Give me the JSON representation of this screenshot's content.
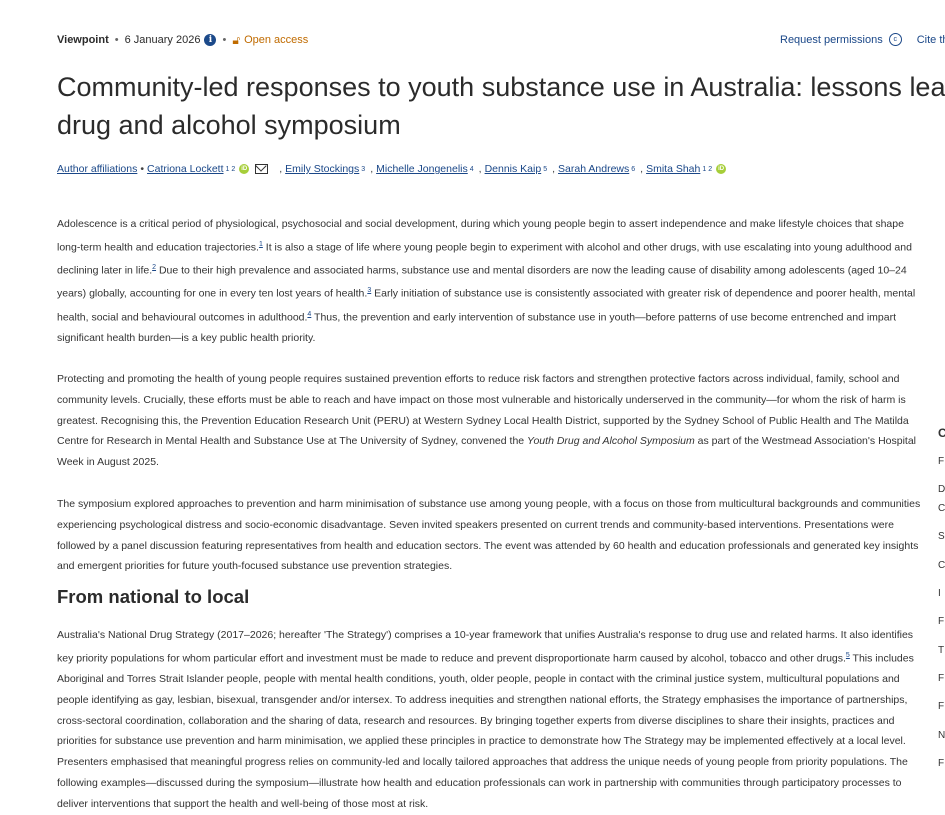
{
  "meta": {
    "article_type": "Viewpoint",
    "date": "6 January 2026",
    "access": "Open access",
    "request_permissions": "Request permissions",
    "cite": "Cite this"
  },
  "title": {
    "line1": "Community-led responses to youth substance use in Australia: lessons learnt",
    "line2": "drug and alcohol symposium"
  },
  "authors": {
    "affiliations": "Author affiliations",
    "list": [
      {
        "name": "Catriona Lockett",
        "sup": "1 2"
      },
      {
        "name": "Emily Stockings",
        "sup": "3"
      },
      {
        "name": "Michelle Jongenelis",
        "sup": "4"
      },
      {
        "name": "Dennis Kaip",
        "sup": "5"
      },
      {
        "name": "Sarah Andrews",
        "sup": "6"
      },
      {
        "name": "Smita Shah",
        "sup": "1 2"
      }
    ]
  },
  "body": {
    "p1": [
      "Adolescence is a critical period of physiological, psychosocial and social development, during which young people begin to assert independence and make lifestyle choices that shape long-term health and education trajectories.",
      "1",
      " It is also a stage of life where young people begin to experiment with alcohol and other drugs, with use escalating into young adulthood and declining later in life.",
      "2",
      " Due to their high prevalence and associated harms, substance use and mental disorders are now the leading cause of disability among adolescents (aged 10–24 years) globally, accounting for one in every ten lost years of health.",
      "3",
      " Early initiation of substance use is consistently associated with greater risk of dependence and poorer health, mental health, social and behavioural outcomes in adulthood.",
      "4",
      " Thus, the prevention and early intervention of substance use in youth—before patterns of use become entrenched and impart significant health burden—is a key public health priority."
    ],
    "p2_before": "Protecting and promoting the health of young people requires sustained prevention efforts to reduce risk factors and strengthen protective factors across individual, family, school and community levels. Crucially, these efforts must be able to reach and have impact on those most vulnerable and historically underserved in the community—for whom the risk of harm is greatest. Recognising this, the Prevention Education Research Unit (PERU) at Western Sydney Local Health District, supported by the Sydney School of Public Health and The Matilda Centre for Research in Mental Health and Substance Use at The University of Sydney, convened the ",
    "p2_italic": "Youth Drug and Alcohol Symposium",
    "p2_after": " as part of the Westmead Association's Hospital Week in August 2025.",
    "p3": "The symposium explored approaches to prevention and harm minimisation of substance use among young people, with a focus on those from multicultural backgrounds and communities experiencing psychological distress and socio-economic disadvantage. Seven invited speakers presented on current trends and community-based interventions. Presentations were followed by a panel discussion featuring representatives from health and education sectors. The event was attended by 60 health and education professionals and generated key insights and emergent priorities for future youth-focused substance use prevention strategies.",
    "h2": "From national to local",
    "p4_before": "Australia's National Drug Strategy (2017–2026; hereafter 'The Strategy') comprises a 10-year framework that unifies Australia's response to drug use and related harms. It also identifies key priority populations for whom particular effort and investment must be made to reduce and prevent disproportionate harm caused by alcohol, tobacco and other drugs.",
    "p4_ref": "5",
    "p4_after": " This includes Aboriginal and Torres Strait Islander people, people with mental health conditions, youth, older people, people in contact with the criminal justice system, multicultural populations and people identifying as gay, lesbian, bisexual, transgender and/or intersex. To address inequities and strengthen national efforts, the Strategy emphasises the importance of partnerships, cross-sectoral coordination, collaboration and the sharing of data, research and resources. By bringing together experts from diverse disciplines to share their insights, practices and priorities for substance use prevention and harm minimisation, we applied these principles in practice to demonstrate how The Strategy may be implemented effectively at a local level. Presenters emphasised that meaningful progress relies on community-led and locally tailored approaches that address the unique needs of young people from priority populations. The following examples—discussed during the symposium—illustrate how health and education professionals can work in partnership with communities through participatory processes to deliver interventions that support the health and well-being of those most at risk."
  },
  "side": [
    "C",
    "F",
    "D",
    "C",
    "S",
    "C",
    "I",
    "F",
    "T",
    "F",
    "F",
    "N",
    "F"
  ]
}
